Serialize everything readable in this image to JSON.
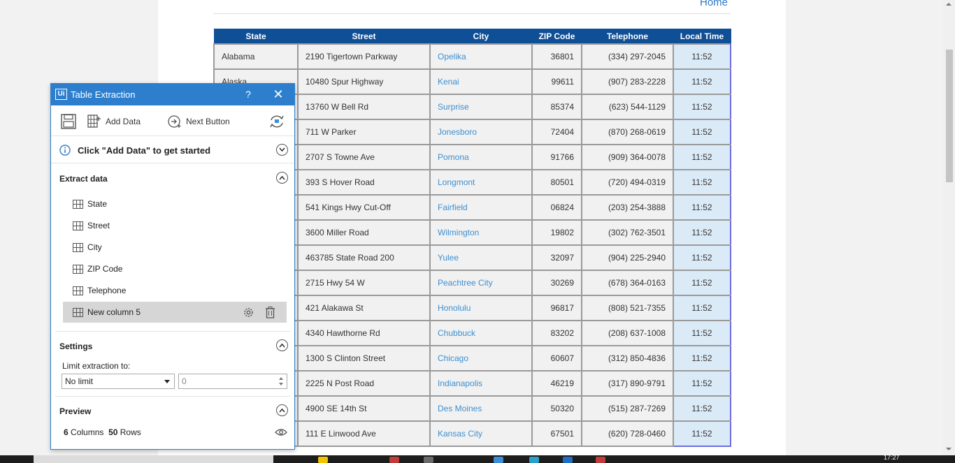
{
  "page": {
    "home_link": "Home"
  },
  "table": {
    "headers": [
      "State",
      "Street",
      "City",
      "ZIP Code",
      "Telephone",
      "Local Time"
    ],
    "rows": [
      [
        "Alabama",
        "2190 Tigertown Parkway",
        "Opelika",
        "36801",
        "(334) 297-2045",
        "11:52"
      ],
      [
        "Alaska",
        "10480 Spur Highway",
        "Kenai",
        "99611",
        "(907) 283-2228",
        "11:52"
      ],
      [
        "",
        "13760 W Bell Rd",
        "Surprise",
        "85374",
        "(623) 544-1129",
        "11:52"
      ],
      [
        "",
        "711 W Parker",
        "Jonesboro",
        "72404",
        "(870) 268-0619",
        "11:52"
      ],
      [
        "",
        "2707 S Towne Ave",
        "Pomona",
        "91766",
        "(909) 364-0078",
        "11:52"
      ],
      [
        "",
        "393 S Hover Road",
        "Longmont",
        "80501",
        "(720) 494-0319",
        "11:52"
      ],
      [
        "",
        "541 Kings Hwy Cut-Off",
        "Fairfield",
        "06824",
        "(203) 254-3888",
        "11:52"
      ],
      [
        "",
        "3600 Miller Road",
        "Wilmington",
        "19802",
        "(302) 762-3501",
        "11:52"
      ],
      [
        "",
        "463785 State Road 200",
        "Yulee",
        "32097",
        "(904) 225-2940",
        "11:52"
      ],
      [
        "",
        "2715 Hwy 54 W",
        "Peachtree City",
        "30269",
        "(678) 364-0163",
        "11:52"
      ],
      [
        "",
        "421 Alakawa St",
        "Honolulu",
        "96817",
        "(808) 521-7355",
        "11:52"
      ],
      [
        "",
        "4340 Hawthorne Rd",
        "Chubbuck",
        "83202",
        "(208) 637-1008",
        "11:52"
      ],
      [
        "",
        "1300 S Clinton Street",
        "Chicago",
        "60607",
        "(312) 850-4836",
        "11:52"
      ],
      [
        "",
        "2225 N Post Road",
        "Indianapolis",
        "46219",
        "(317) 890-9791",
        "11:52"
      ],
      [
        "",
        "4900 SE 14th St",
        "Des Moines",
        "50320",
        "(515) 287-7269",
        "11:52"
      ],
      [
        "",
        "111 E Linwood Ave",
        "Kansas City",
        "67501",
        "(620) 728-0460",
        "11:52"
      ]
    ]
  },
  "dialog": {
    "title": "Table Extraction",
    "logo_text": "Ui",
    "help_glyph": "?",
    "close_glyph": "✕",
    "toolbar": {
      "add_data_label": "Add Data",
      "next_button_label": "Next Button"
    },
    "hint": "Click \"Add Data\" to get started",
    "extract": {
      "title": "Extract data",
      "columns": [
        "State",
        "Street",
        "City",
        "ZIP Code",
        "Telephone",
        "New column 5"
      ]
    },
    "settings": {
      "title": "Settings",
      "limit_label": "Limit extraction to:",
      "limit_value": "No limit",
      "limit_number": "0"
    },
    "preview": {
      "title": "Preview",
      "columns_count": "6",
      "columns_label": "Columns",
      "rows_count": "50",
      "rows_label": "Rows"
    }
  },
  "taskbar": {
    "clock": "17:27"
  },
  "colors": {
    "header_bg": "#0f4f96",
    "dialog_accent": "#2d7fce",
    "link": "#3e8fcf",
    "time_cell_bg": "#dbeaf7"
  }
}
